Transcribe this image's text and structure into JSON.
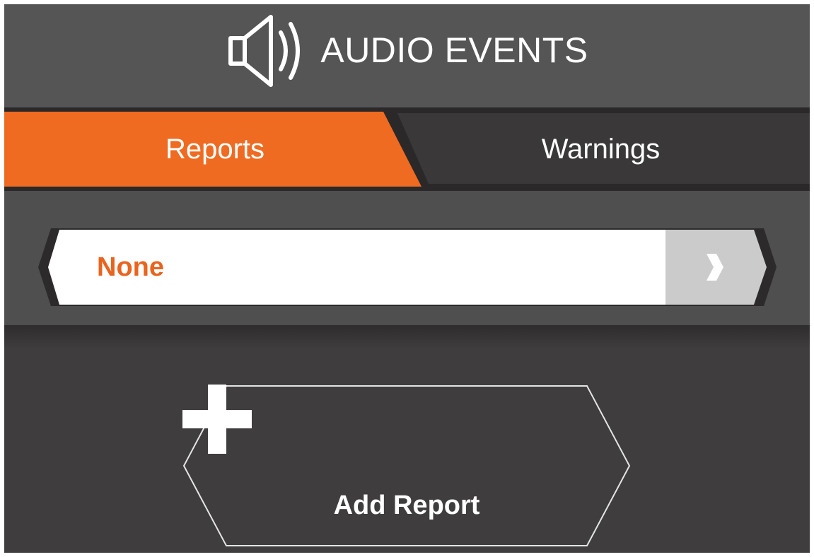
{
  "header": {
    "title": "AUDIO EVENTS",
    "icon": "speaker-icon"
  },
  "tabs": [
    {
      "label": "Reports",
      "active": true
    },
    {
      "label": "Warnings",
      "active": false
    }
  ],
  "selector": {
    "value": "None",
    "next_icon": "chevron-right-icon"
  },
  "add_report": {
    "label": "Add Report",
    "icon": "plus-icon"
  },
  "colors": {
    "accent": "#ef6b21",
    "header_bg": "#555555",
    "body_bg": "#3f3d3d",
    "selector_bg": "#4f4f4f"
  }
}
